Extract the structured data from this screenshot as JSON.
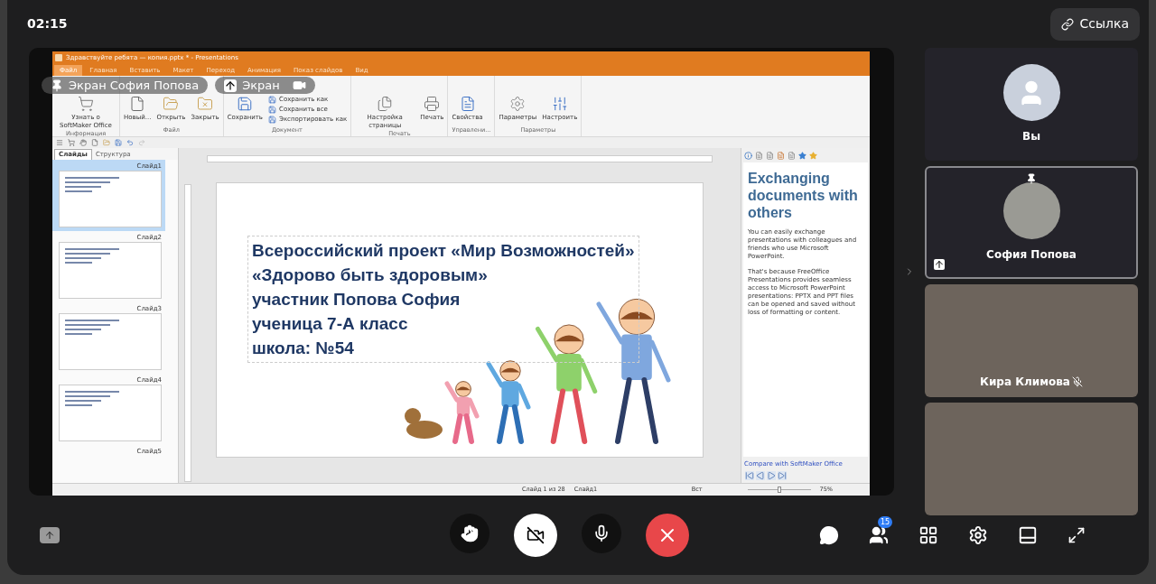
{
  "top_bar": {
    "time": "02:15",
    "link_button": "Ссылка"
  },
  "screen_share": {
    "labels": [
      {
        "kind": "pinned",
        "text": "Экран София Попова"
      },
      {
        "kind": "share",
        "text": "Экран"
      }
    ]
  },
  "app": {
    "title": "Здравствуйте ребята — копия.pptx * - Presentations",
    "menu_tabs": [
      {
        "label": "Файл",
        "selected": true
      },
      {
        "label": "Главная",
        "selected": false
      },
      {
        "label": "Вставить",
        "selected": false
      },
      {
        "label": "Макет",
        "selected": false
      },
      {
        "label": "Переход",
        "selected": false
      },
      {
        "label": "Анимация",
        "selected": false
      },
      {
        "label": "Показ слайдов",
        "selected": false
      },
      {
        "label": "Вид",
        "selected": false
      }
    ],
    "ribbon_groups": [
      {
        "title": "Информация",
        "commands": [
          {
            "kind": "cart",
            "label": "Узнать о SoftMaker Office"
          }
        ]
      },
      {
        "title": "Файл",
        "commands": [
          {
            "kind": "new",
            "label": "Новый..."
          },
          {
            "kind": "open",
            "label": "Открыть"
          },
          {
            "kind": "close",
            "label": "Закрыть"
          }
        ]
      },
      {
        "title": "Документ",
        "commands": [
          {
            "kind": "save",
            "label": "Сохранить"
          },
          {
            "kind": "small",
            "label": "Сохранить как"
          },
          {
            "kind": "small",
            "label": "Сохранить все"
          },
          {
            "kind": "small",
            "label": "Экспортировать как"
          }
        ]
      },
      {
        "title": "Печать",
        "commands": [
          {
            "kind": "pagesetup",
            "label": "Настройка страницы"
          },
          {
            "kind": "print",
            "label": "Печать"
          }
        ]
      },
      {
        "title": "Управлени...",
        "commands": [
          {
            "kind": "props",
            "label": "Свойства"
          }
        ]
      },
      {
        "title": "Параметры",
        "commands": [
          {
            "kind": "options",
            "label": "Параметры"
          },
          {
            "kind": "customize",
            "label": "Настроить"
          }
        ]
      }
    ],
    "side_tabs": [
      {
        "label": "Слайды",
        "selected": true
      },
      {
        "label": "Структура",
        "selected": false
      }
    ],
    "slides": [
      {
        "label": "Слайд1",
        "selected": true
      },
      {
        "label": "Слайд2",
        "selected": false
      },
      {
        "label": "Слайд3",
        "selected": false
      },
      {
        "label": "Слайд4",
        "selected": false
      },
      {
        "label": "Слайд5",
        "selected": false
      }
    ],
    "slide_lines": [
      "Всероссийский проект «Мир Возможностей»",
      "«Здорово быть здоровым»",
      "участник Попова София",
      "ученица 7-А класс",
      "школа: №54"
    ],
    "info_panel": {
      "heading": "Exchanging documents with others",
      "paragraphs": [
        "You can easily exchange presentations with colleagues and friends who use Microsoft PowerPoint.",
        "That's because FreeOffice Presentations provides seamless access to Microsoft PowerPoint presentations: PPTX and PPT files can be opened and saved without loss of formatting or content."
      ],
      "link": "Compare with SoftMaker Office"
    },
    "status_bar": {
      "position": "Слайд 1 из 28",
      "slide_name": "Слайд1",
      "mode": "Вст",
      "zoom": "75%",
      "zoom_slider": {
        "level": 0.5
      }
    }
  },
  "participants": [
    {
      "name": "Вы",
      "kind": "avatar",
      "selected": false,
      "pinned": false,
      "sharing": false,
      "muted": false
    },
    {
      "name": "София Попова",
      "kind": "photo",
      "selected": true,
      "pinned": true,
      "sharing": true,
      "muted": false
    },
    {
      "name": "Кира Климова",
      "kind": "video",
      "selected": false,
      "pinned": false,
      "sharing": false,
      "muted": true
    },
    {
      "kind": "video",
      "selected": false,
      "pinned": false,
      "sharing": false,
      "muted": false
    }
  ],
  "call_controls": {
    "camera_on": false,
    "mic_on": true,
    "participants_badge": "15"
  }
}
